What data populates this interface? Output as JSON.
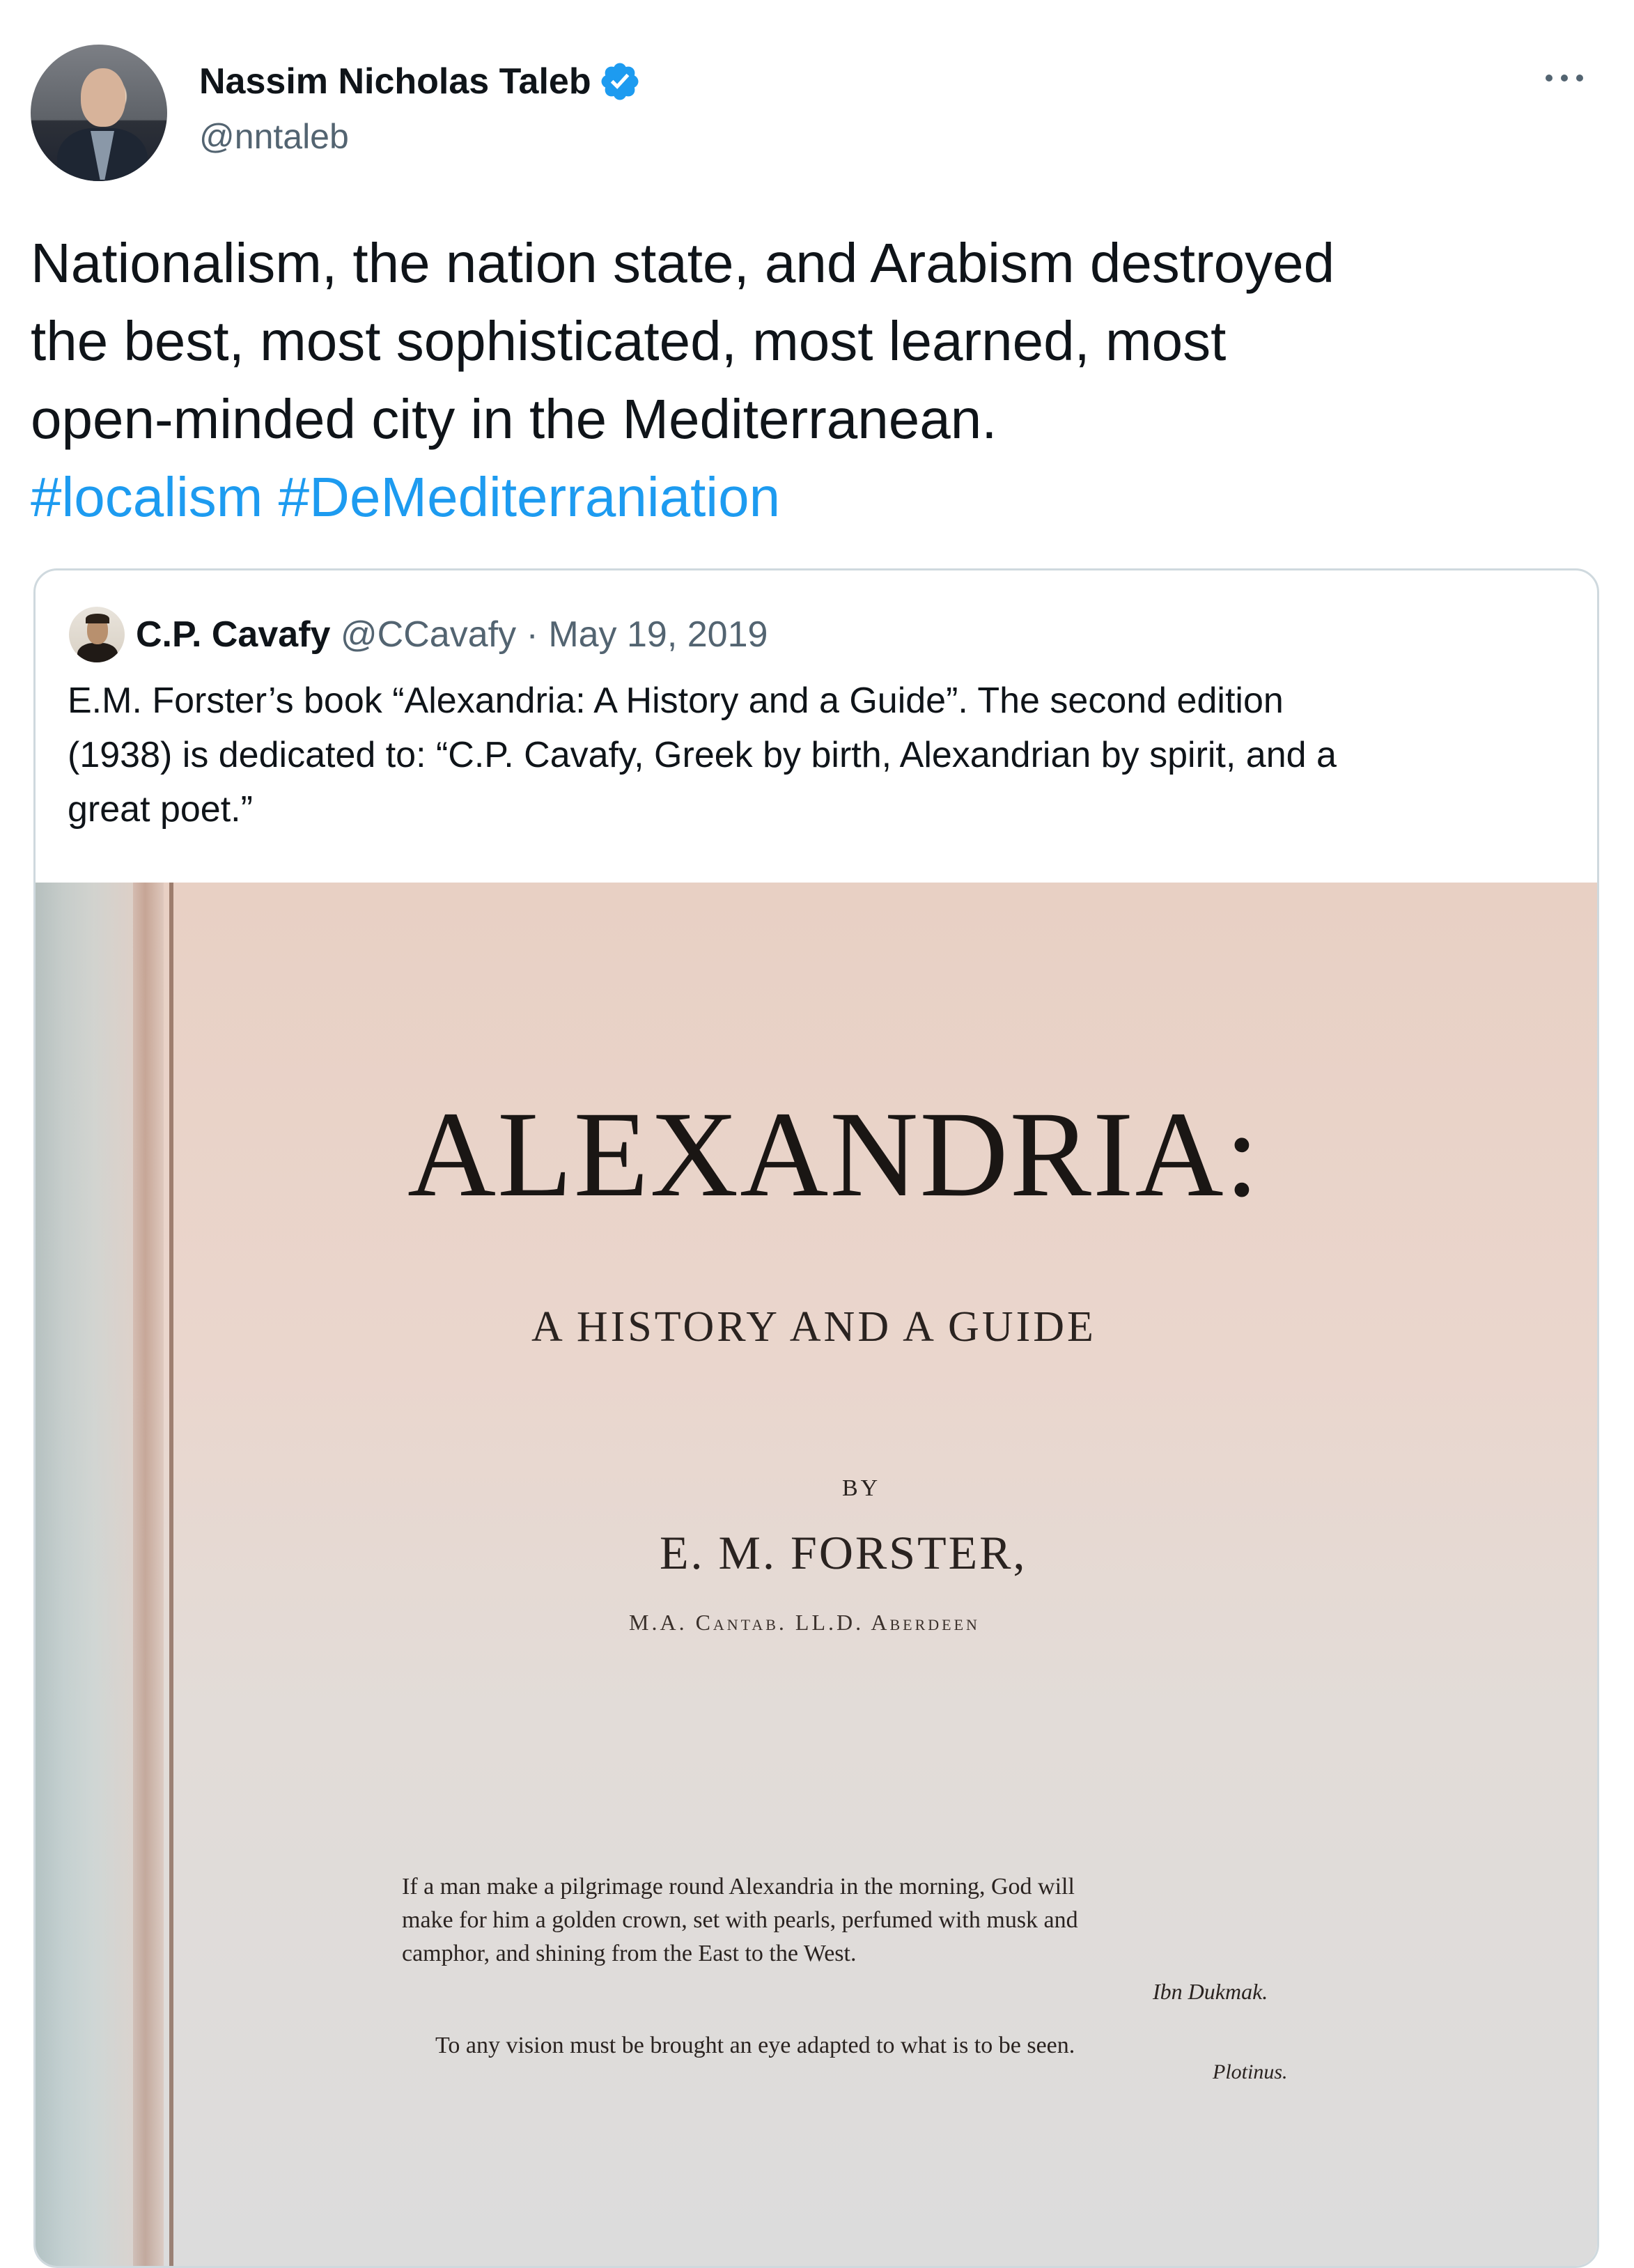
{
  "tweet": {
    "author_name": "Nassim Nicholas Taleb",
    "handle": "@nntaleb",
    "verified_icon": "verified-badge-icon",
    "more_icon": "more-options-icon",
    "text_lines": [
      "Nationalism, the nation state, and Arabism destroyed",
      "the best, most sophisticated, most learned, most",
      "open-minded city in the Mediterranean."
    ],
    "hashtags": [
      "#localism",
      "#DeMediterraniation"
    ],
    "link_color": "#1d9bf0"
  },
  "quoted_tweet": {
    "author_name": "C.P. Cavafy",
    "handle": "@CCavafy",
    "separator": "·",
    "date": "May 19, 2019",
    "text_lines": [
      "E.M. Forster’s book “Alexandria: A History and a Guide”. The second edition",
      "(1938) is dedicated to: “C.P. Cavafy, Greek by birth, Alexandrian by spirit, and a",
      "great poet.”"
    ],
    "image": {
      "title": "ALEXANDRIA:",
      "subtitle": "A HISTORY AND A GUIDE",
      "by": "BY",
      "author": "E. M. FORSTER,",
      "degrees": "M.A. Cantab. LL.D. Aberdeen",
      "epigraph_lines": [
        "If a man make a pilgrimage round Alexandria in the morning, God will",
        "make for him a golden crown, set with pearls, perfumed with musk and",
        "camphor, and shining from the East to the West."
      ],
      "epigraph_attribution": "Ibn Dukmak.",
      "epigraph2": "To any vision must be brought an eye adapted to what is to be seen.",
      "epigraph2_attribution": "Plotinus."
    }
  }
}
